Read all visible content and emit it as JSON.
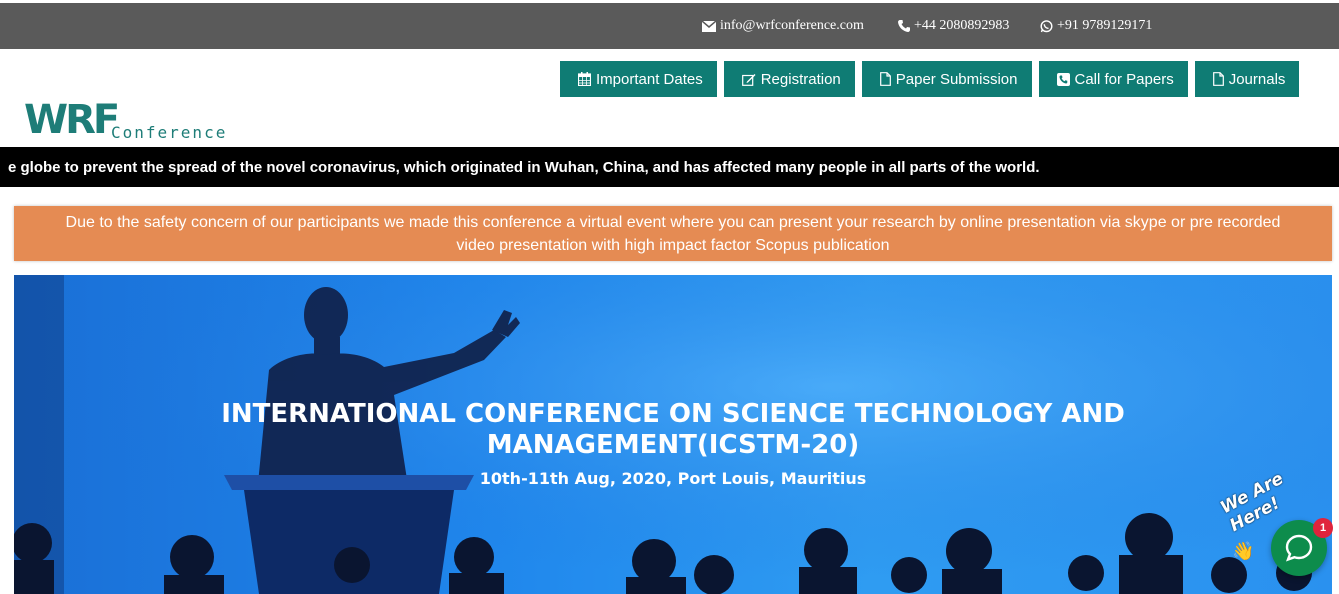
{
  "topbar": {
    "email": "info@wrfconference.com",
    "phone": "+44 2080892983",
    "whatsapp": "+91 9789129171"
  },
  "logo": {
    "mark": "WRF",
    "subtitle": "Conference"
  },
  "nav": [
    {
      "label": "Important Dates",
      "icon": "calendar-icon"
    },
    {
      "label": "Registration",
      "icon": "edit-icon"
    },
    {
      "label": "Paper Submission",
      "icon": "document-icon"
    },
    {
      "label": "Call for Papers",
      "icon": "phone-square-icon"
    },
    {
      "label": "Journals",
      "icon": "document-icon"
    }
  ],
  "ticker": {
    "text": "e globe to prevent the spread of the novel coronavirus, which originated in Wuhan, China, and has affected many people in all parts of the world."
  },
  "notice": {
    "line1": "Due to the safety concern of our participants we made this conference a virtual event where you can present your research by online presentation via skype or pre recorded",
    "line2": "video presentation with high impact factor Scopus publication"
  },
  "hero": {
    "title_line1": "INTERNATIONAL CONFERENCE ON SCIENCE TECHNOLOGY AND",
    "title_line2": "MANAGEMENT(ICSTM-20)",
    "date": "10th-11th Aug, 2020, Port Louis, Mauritius"
  },
  "chat": {
    "label": "We Are Here!",
    "badge": "1"
  },
  "colors": {
    "topbar": "#5a5a5a",
    "nav_button": "#0f7c74",
    "notice": "#e58b53",
    "hero": "#1f86ec",
    "chat": "#0d8c4c"
  }
}
